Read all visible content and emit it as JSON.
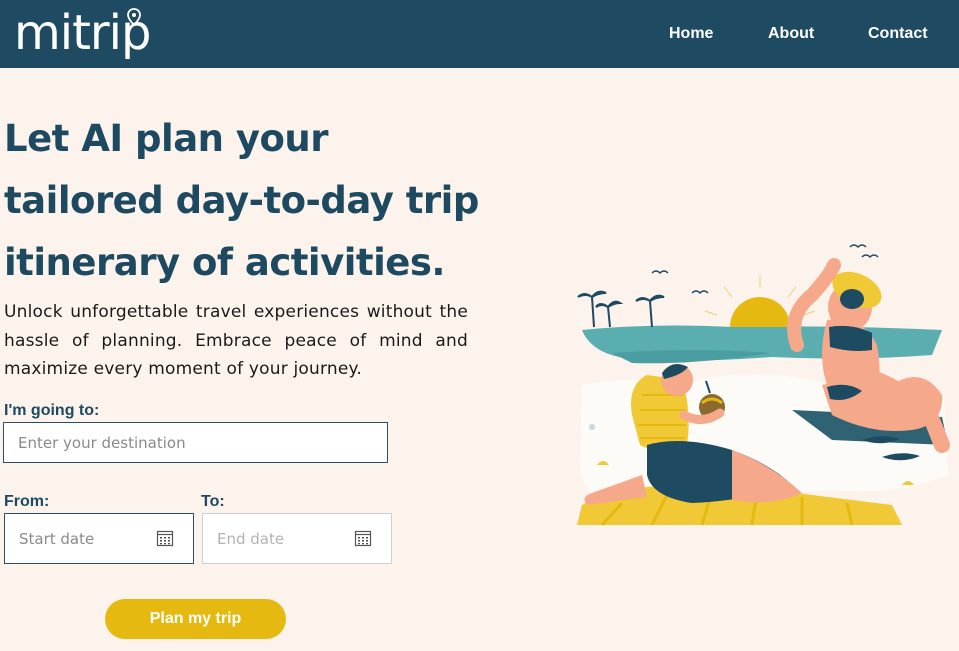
{
  "nav": {
    "logo_text": "mitrip",
    "links": [
      "Home",
      "About",
      "Contact"
    ]
  },
  "hero": {
    "headline": "Let AI plan your tailored day-to-day trip itinerary of activities.",
    "subtitle": "Unlock unforgettable travel experiences without the hassle of planning. Embrace peace of mind and maximize every moment of your journey."
  },
  "form": {
    "destination_label": "I'm going to:",
    "destination_placeholder": "Enter your destination",
    "from_label": "From:",
    "from_placeholder": "Start date",
    "to_label": "To:",
    "to_placeholder": "End date",
    "submit_label": "Plan my trip"
  },
  "icons": {
    "calendar": "calendar-icon",
    "pin": "map-pin-icon"
  },
  "colors": {
    "nav_bg": "#1f4b62",
    "page_bg": "#fcf3ec",
    "heading": "#1d4a61",
    "accent": "#e5b910"
  }
}
